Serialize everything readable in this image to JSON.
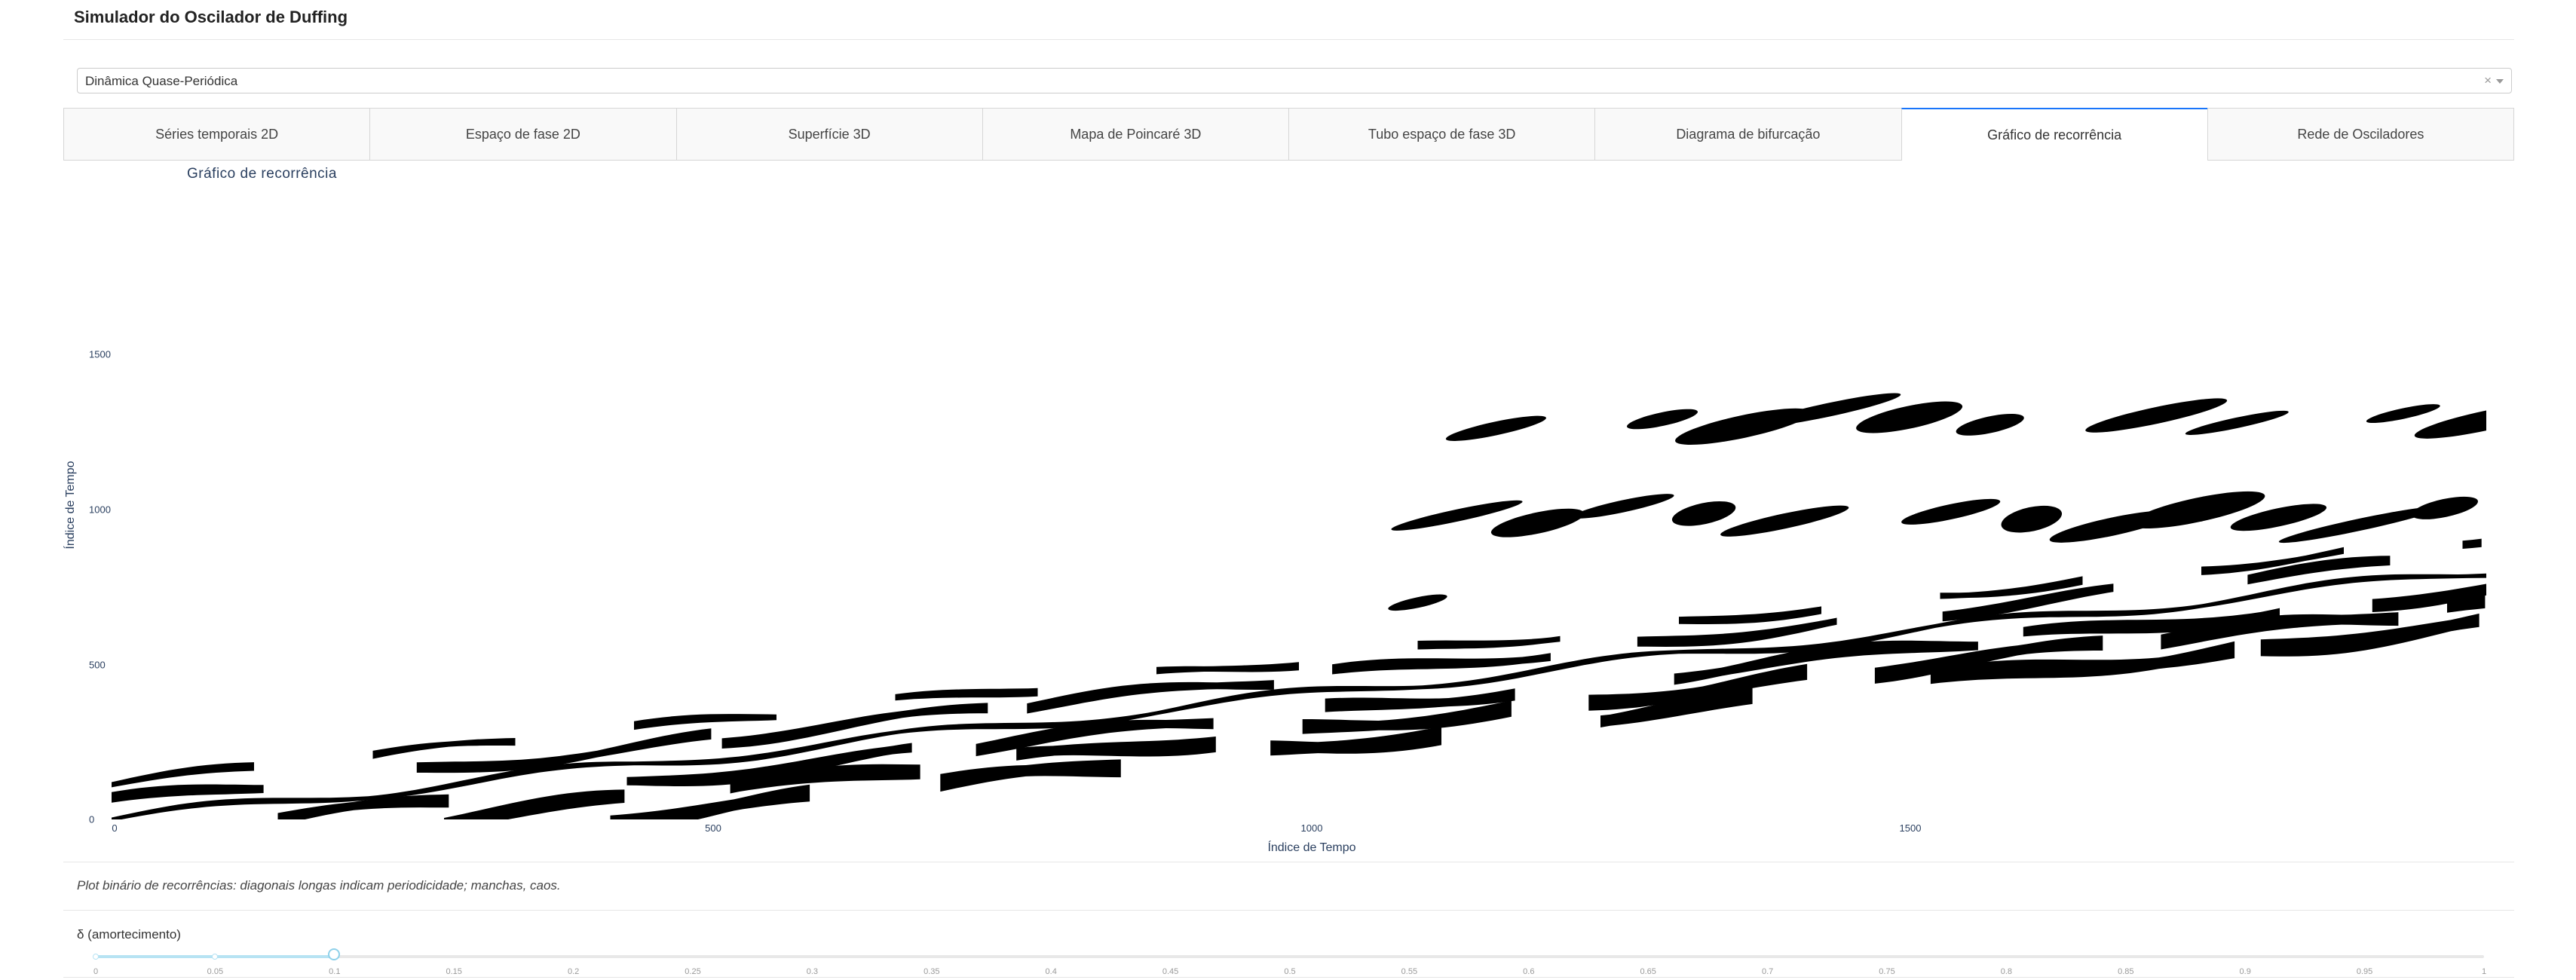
{
  "app": {
    "title": "Simulador do Oscilador de Duffing"
  },
  "preset": {
    "value": "Dinâmica Quase-Periódica",
    "clear_glyph": "×"
  },
  "tabs": [
    {
      "label": "Séries temporais 2D",
      "active": false
    },
    {
      "label": "Espaço de fase 2D",
      "active": false
    },
    {
      "label": "Superfície 3D",
      "active": false
    },
    {
      "label": "Mapa de Poincaré 3D",
      "active": false
    },
    {
      "label": "Tubo espaço de fase 3D",
      "active": false
    },
    {
      "label": "Diagrama de bifurcação",
      "active": false
    },
    {
      "label": "Gráfico de recorrência",
      "active": true
    },
    {
      "label": "Rede de Osciladores",
      "active": false
    }
  ],
  "chart_data": {
    "type": "heatmap",
    "title": "Gráfico de recorrência",
    "xlabel": "Índice de Tempo",
    "ylabel": "Índice de Tempo",
    "x_range": [
      0,
      2000
    ],
    "y_range": [
      0,
      2000
    ],
    "x_ticks": [
      0,
      500,
      1000,
      1500
    ],
    "y_ticks": [
      0,
      500,
      1000,
      1500
    ],
    "colors": [
      "#ffffff",
      "#000000"
    ],
    "binary": true,
    "main_diagonal_slope": 0.4,
    "line_offsets": [
      -280,
      -140,
      140,
      280,
      420
    ],
    "grid": false
  },
  "caption": "Plot binário de recorrências: diagonais longas indicam periodicidade; manchas, caos.",
  "slider": {
    "label": "δ (amortecimento)",
    "value": 0.1,
    "min": 0,
    "max": 1,
    "marks": [
      "0",
      "0.05",
      "0.1",
      "0.15",
      "0.2",
      "0.25",
      "0.3",
      "0.35",
      "0.4",
      "0.45",
      "0.5",
      "0.55",
      "0.6",
      "0.65",
      "0.7",
      "0.75",
      "0.8",
      "0.85",
      "0.9",
      "0.95",
      "1"
    ]
  }
}
